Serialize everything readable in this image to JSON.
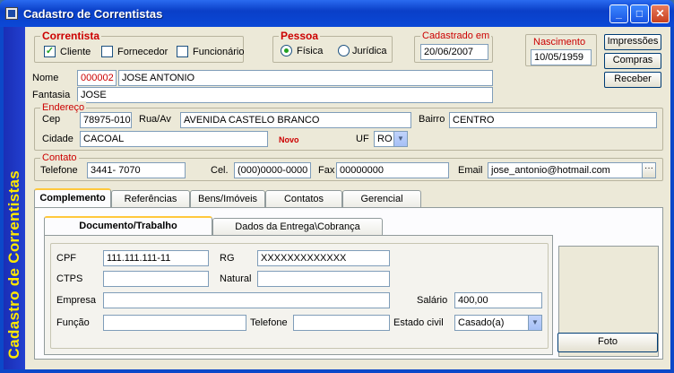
{
  "window": {
    "title": "Cadastro de Correntistas",
    "vertical_banner": "Cadastro de Correntistas"
  },
  "groups": {
    "correntista": {
      "legend": "Correntista",
      "options": [
        {
          "label": "Cliente",
          "checked": true
        },
        {
          "label": "Fornecedor",
          "checked": false
        },
        {
          "label": "Funcionário",
          "checked": false
        }
      ]
    },
    "pessoa": {
      "legend": "Pessoa",
      "options": [
        {
          "label": "Física",
          "selected": true
        },
        {
          "label": "Jurídica",
          "selected": false
        }
      ]
    },
    "cadastrado": {
      "legend": "Cadastrado em",
      "value": "20/06/2007"
    },
    "nascimento": {
      "legend": "Nascimento",
      "value": "10/05/1959"
    },
    "endereco": {
      "legend": "Endereço"
    },
    "contato": {
      "legend": "Contato"
    }
  },
  "actions": {
    "impressoes": "Impressões",
    "compras": "Compras",
    "receber": "Receber"
  },
  "fields": {
    "nome": {
      "label": "Nome",
      "code": "000002",
      "value": "JOSE ANTONIO"
    },
    "fantasia": {
      "label": "Fantasia",
      "value": "JOSE"
    },
    "cep": {
      "label": "Cep",
      "value": "78975-010"
    },
    "rua": {
      "label": "Rua/Av",
      "value": "AVENIDA CASTELO BRANCO"
    },
    "bairro": {
      "label": "Bairro",
      "value": "CENTRO"
    },
    "cidade": {
      "label": "Cidade",
      "value": "CACOAL"
    },
    "novo": "Novo",
    "uf": {
      "label": "UF",
      "value": "RO"
    },
    "telefone": {
      "label": "Telefone",
      "value": "3441- 7070"
    },
    "cel": {
      "label": "Cel.",
      "value": "(000)0000-0000"
    },
    "fax": {
      "label": "Fax",
      "value": "00000000"
    },
    "email": {
      "label": "Email",
      "value": "jose_antonio@hotmail.com"
    }
  },
  "main_tabs": [
    "Complemento",
    "Referências",
    "Bens/Imóveis",
    "Contatos",
    "Gerencial"
  ],
  "sub_tabs": [
    "Documento/Trabalho",
    "Dados da Entrega\\Cobrança"
  ],
  "doc": {
    "cpf": {
      "label": "CPF",
      "value": "111.111.111-11"
    },
    "rg": {
      "label": "RG",
      "value": "XXXXXXXXXXXXX"
    },
    "ctps": {
      "label": "CTPS",
      "value": ""
    },
    "natural": {
      "label": "Natural",
      "value": ""
    },
    "empresa": {
      "label": "Empresa",
      "value": ""
    },
    "salario": {
      "label": "Salário",
      "value": "400,00"
    },
    "funcao": {
      "label": "Função",
      "value": ""
    },
    "telefone": {
      "label": "Telefone",
      "value": ""
    },
    "estado_civil": {
      "label": "Estado civil",
      "value": "Casado(a)"
    }
  },
  "foto_button": "Foto",
  "colors": {
    "titlebar": "#0b48d6",
    "banner": "#1a2eb6",
    "banner_text": "#ffe800",
    "legend": "#cc0000"
  }
}
